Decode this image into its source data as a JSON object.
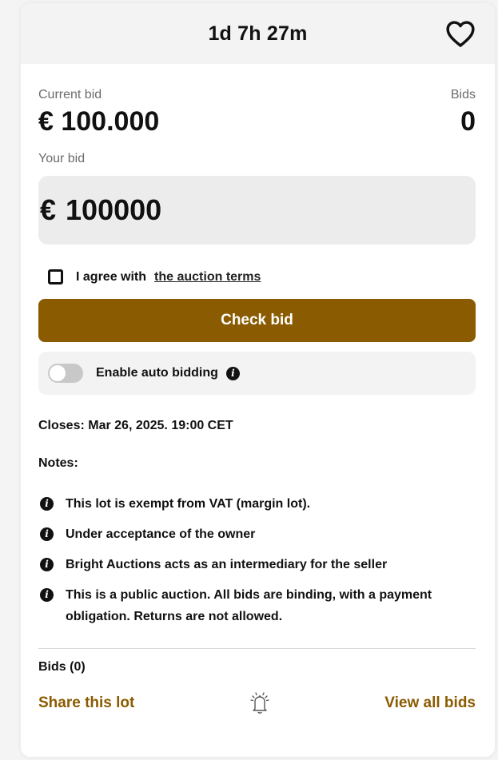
{
  "header": {
    "countdown": "1d 7h 27m",
    "favorite_icon": "heart-icon"
  },
  "bid_summary": {
    "current_bid_label": "Current bid",
    "current_bid_value": "€ 100.000",
    "bids_label": "Bids",
    "bids_value": "0"
  },
  "your_bid": {
    "label": "Your bid",
    "currency": "€",
    "value": "100000"
  },
  "terms": {
    "agree_text": "I agree with",
    "link_text": "the auction terms",
    "checked": false
  },
  "check_button": {
    "label": "Check bid"
  },
  "auto_bidding": {
    "label": "Enable auto bidding",
    "enabled": false,
    "info_icon": "info-icon"
  },
  "closes": "Closes: Mar 26, 2025. 19:00 CET",
  "notes": {
    "title": "Notes:",
    "items": [
      "This lot is exempt from VAT (margin lot).",
      "Under acceptance of the owner",
      "Bright Auctions acts as an intermediary for the seller",
      "This is a public auction. All bids are binding, with a payment obligation. Returns are not allowed."
    ]
  },
  "bids_count": "Bids (0)",
  "footer": {
    "share_label": "Share this lot",
    "bell_icon": "bell-icon",
    "view_all_label": "View all bids"
  },
  "colors": {
    "accent": "#8a5b00",
    "header_bg": "#f3f3f3",
    "input_bg": "#ececec"
  }
}
